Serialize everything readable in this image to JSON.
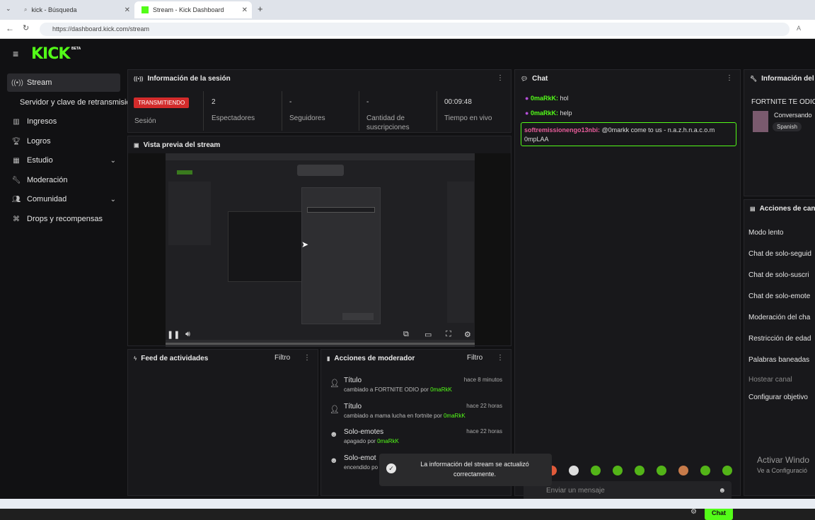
{
  "browser": {
    "tabs": [
      {
        "label": "kick - Búsqueda"
      },
      {
        "label": "Stream - Kick Dashboard"
      }
    ],
    "new_tab": "+",
    "url": "https://dashboard.kick.com/stream"
  },
  "brand": {
    "logo": "KICK",
    "beta": "BETA",
    "accent": "#53fc18"
  },
  "sidebar": {
    "items": [
      {
        "label": "Stream",
        "icon": "broadcast-icon"
      },
      {
        "label": "Servidor y clave de retransmisión",
        "icon": ""
      },
      {
        "label": "Ingresos",
        "icon": "chart-icon"
      },
      {
        "label": "Logros",
        "icon": "trophy-icon"
      },
      {
        "label": "Estudio",
        "icon": "layout-icon"
      },
      {
        "label": "Moderación",
        "icon": "wrench-icon"
      },
      {
        "label": "Comunidad",
        "icon": "users-icon"
      },
      {
        "label": "Drops y recompensas",
        "icon": "gift-icon"
      }
    ]
  },
  "session": {
    "title": "Información de la sesión",
    "status": "TRANSMITIENDO",
    "status_label": "Sesión",
    "viewers": "2",
    "viewers_label": "Espectadores",
    "followers": "-",
    "followers_label": "Seguidores",
    "subs": "-",
    "subs_label": "Cantidad de suscripciones",
    "live_time": "00:09:48",
    "live_time_label": "Tiempo en vivo"
  },
  "preview": {
    "title": "Vista previa del stream"
  },
  "feed": {
    "title": "Feed de actividades",
    "filter": "Filtro"
  },
  "mod_actions": {
    "title": "Acciones de moderador",
    "filter": "Filtro",
    "items": [
      {
        "title": "Título",
        "time": "hace 8 minutos",
        "desc_pre": "cambiado a FORTNITE ODIO por",
        "user": "0maRkK"
      },
      {
        "title": "Título",
        "time": "hace 22 horas",
        "desc_pre": "cambiado a mama lucha en fortnite por",
        "user": "0maRkK"
      },
      {
        "title": "Solo-emotes",
        "time": "hace 22 horas",
        "desc_pre": "apagado por",
        "user": "0maRkK"
      },
      {
        "title": "Solo-emot",
        "time": "",
        "desc_pre": "encendido po",
        "user": ""
      }
    ]
  },
  "chat": {
    "title": "Chat",
    "messages": [
      {
        "user": "0maRkK:",
        "text": "hol"
      },
      {
        "user": "0maRkK:",
        "text": "help"
      }
    ],
    "highlight": {
      "user": "softremissionengo13nbi:",
      "text": "@0markk come to us - n.a.z.h.n.a.c.o.m 0mpLAA"
    },
    "input_placeholder": "Enviar un mensaje",
    "send": "Chat"
  },
  "right_panel": {
    "info_title": "Información del s",
    "stream_title": "FORTNITE TE ODIO",
    "category": "Conversando",
    "tag": "Spanish",
    "actions_title": "Acciones de cana",
    "actions": [
      "Modo lento",
      "Chat de solo-seguid",
      "Chat de solo-suscri",
      "Chat de solo-emote",
      "Moderación del cha",
      "Restricción de edad",
      "Palabras baneadas",
      "Hostear canal",
      "Configurar objetivo"
    ]
  },
  "toast": {
    "text": "La información del stream se actualizó correctamente."
  },
  "windows_watermark": {
    "line1": "Activar Windo",
    "line2": "Ve a Configuració"
  }
}
